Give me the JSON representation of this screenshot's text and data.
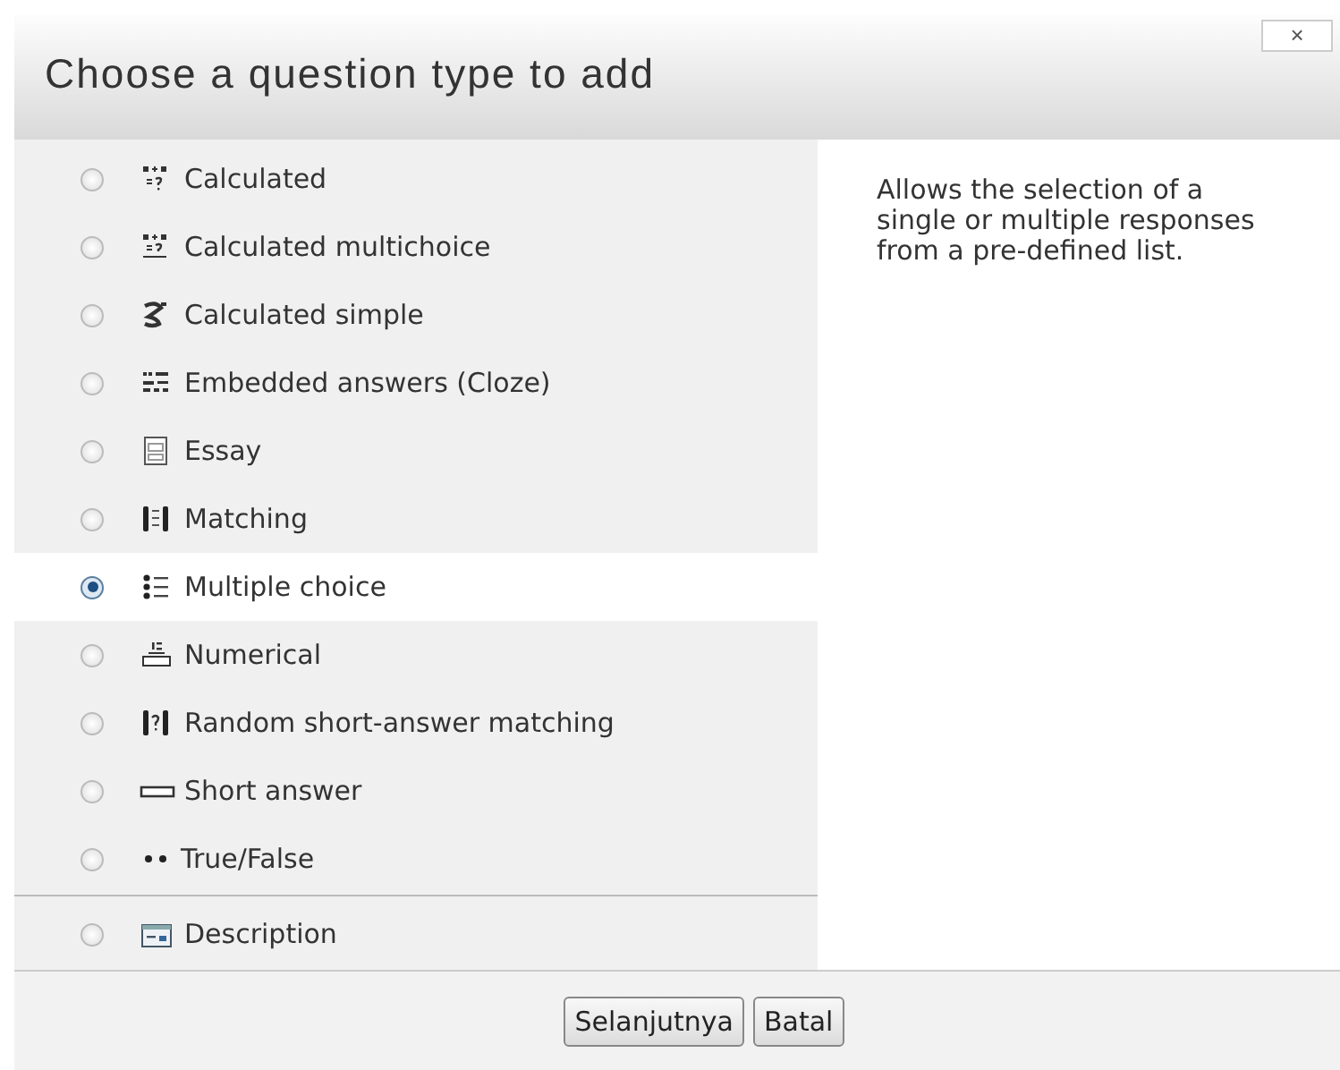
{
  "dialog": {
    "title": "Choose a question type to add",
    "close": "×"
  },
  "question_types": [
    {
      "label": "Calculated",
      "kind": "calculated",
      "selected": false
    },
    {
      "label": "Calculated multichoice",
      "kind": "calcmulti",
      "selected": false
    },
    {
      "label": "Calculated simple",
      "kind": "calcsimple",
      "selected": false
    },
    {
      "label": "Embedded answers (Cloze)",
      "kind": "cloze",
      "selected": false
    },
    {
      "label": "Essay",
      "kind": "essay",
      "selected": false
    },
    {
      "label": "Matching",
      "kind": "matching",
      "selected": false
    },
    {
      "label": "Multiple choice",
      "kind": "multichoice",
      "selected": true
    },
    {
      "label": "Numerical",
      "kind": "numerical",
      "selected": false
    },
    {
      "label": "Random short-answer matching",
      "kind": "randommatch",
      "selected": false
    },
    {
      "label": "Short answer",
      "kind": "shortanswer",
      "selected": false
    },
    {
      "label": "True/False",
      "kind": "truefalse",
      "selected": false
    }
  ],
  "other_types": [
    {
      "label": "Description",
      "kind": "description",
      "selected": false
    }
  ],
  "summary": "Allows the selection of a single or multiple responses from a pre-defined list.",
  "buttons": [
    {
      "label": "Selanjutnya"
    },
    {
      "label": "Batal"
    }
  ]
}
